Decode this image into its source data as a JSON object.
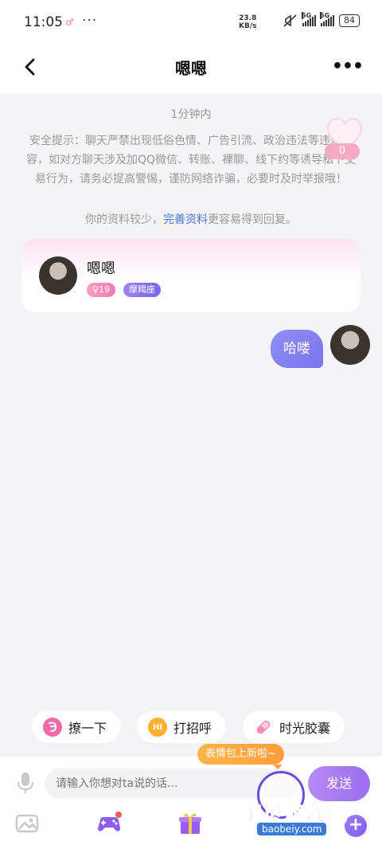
{
  "status_bar": {
    "time": "11:05",
    "gender_symbol": "♂",
    "more_dots": "···",
    "net_speed_value": "23.8",
    "net_speed_unit": "KB/s",
    "sim1_label": "5G",
    "sim2_label": "5G",
    "battery": "84"
  },
  "header": {
    "title": "嗯嗯",
    "more_label": "•••"
  },
  "chat": {
    "timestamp": "1分钟内",
    "safety_tip": "安全提示：聊天严禁出现低俗色情、广告引流、政治违法等违规内容，如对方聊天涉及加QQ微信、转账、裸聊、线下约等诱导私下交易行为，请务必提高警惕，谨防网络诈骗，必要时及时举报哦！",
    "profile_hint_before": "你的资料较少，",
    "profile_hint_link": "完善资料",
    "profile_hint_after": "更容易得到回复。",
    "heart_count": "0"
  },
  "profile_card": {
    "name": "嗯嗯",
    "age": "♀19",
    "zodiac": "摩羯座"
  },
  "messages": [
    {
      "from": "me",
      "text": "哈喽"
    }
  ],
  "quick_actions": [
    {
      "label": "撩一下",
      "icon": "flirt-icon",
      "color": "#f06aa8"
    },
    {
      "label": "打招呼",
      "icon": "hi-icon",
      "color": "#ffb02e"
    },
    {
      "label": "时光胶囊",
      "icon": "capsule-icon",
      "color": "#f58bb0"
    }
  ],
  "input": {
    "placeholder": "请输入你想对ta说的话...",
    "sticker_tip": "表情包上新啦~",
    "send_label": "发送"
  },
  "toolbar": {
    "plus_label": "+"
  },
  "watermark": {
    "text": "宝贝游戏网",
    "url": "baobeiy.com"
  },
  "colors": {
    "accent": "#7c73ee",
    "link": "#4c74e0",
    "send": "#9a6ef0"
  }
}
